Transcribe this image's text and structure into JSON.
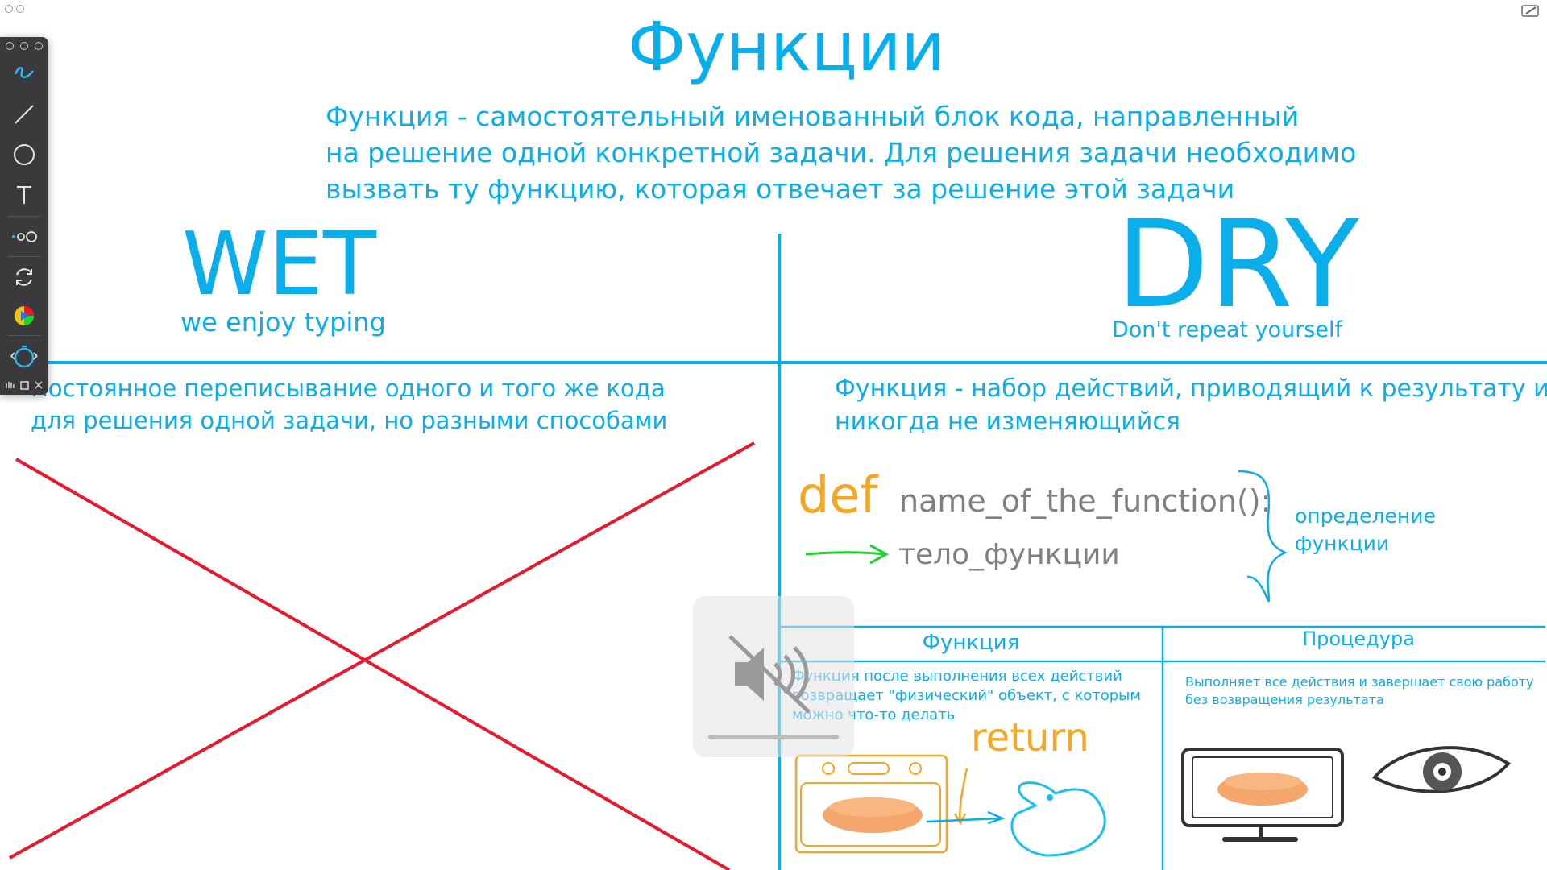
{
  "title": "Функции",
  "subtitle": [
    "Функция - самостоятельный именованный блок кода, направленный",
    "на решение одной конкретной задачи. Для решения задачи необходимо",
    "вызвать ту функцию, которая отвечает за решение этой задачи"
  ],
  "wet": {
    "heading": "WET",
    "subtitle": "we enjoy typing",
    "text": [
      "Постоянное переписывание одного и того же кода",
      "для решения одной задачи, но разными способами"
    ]
  },
  "dry": {
    "heading": "DRY",
    "subtitle": "Don't repeat yourself",
    "text": [
      "Функция - набор действий, приводящий к результату и",
      "никогда не изменяющийся"
    ]
  },
  "definition": {
    "keyword": "def",
    "name": "name_of_the_function():",
    "body": "тело_функции",
    "label": [
      "определение",
      "функции"
    ]
  },
  "comparison": {
    "function_header": "Функция",
    "procedure_header": "Процедура",
    "function_desc": [
      "Функция после выполнения всех действий",
      "возвращает \"физический\" объект, с которым",
      "можно что-то делать"
    ],
    "procedure_desc": [
      "Выполняет все действия и завершает свою работу",
      "без возвращения результата"
    ],
    "return_label": "return"
  },
  "colors": {
    "accent_blue": "#0aaeea",
    "orange": "#f5a623",
    "cross_red": "#e8192c",
    "arrow_green": "#1ed52a",
    "toolbar_bg": "#3a3a3c"
  },
  "toolbar": {
    "tools": [
      "pen-icon",
      "line-icon",
      "circle-icon",
      "text-icon",
      "stroke-width-icon",
      "sync-icon",
      "color-picker-icon",
      "timer-icon"
    ]
  },
  "overlay": {
    "icon": "speaker-muted-icon"
  }
}
